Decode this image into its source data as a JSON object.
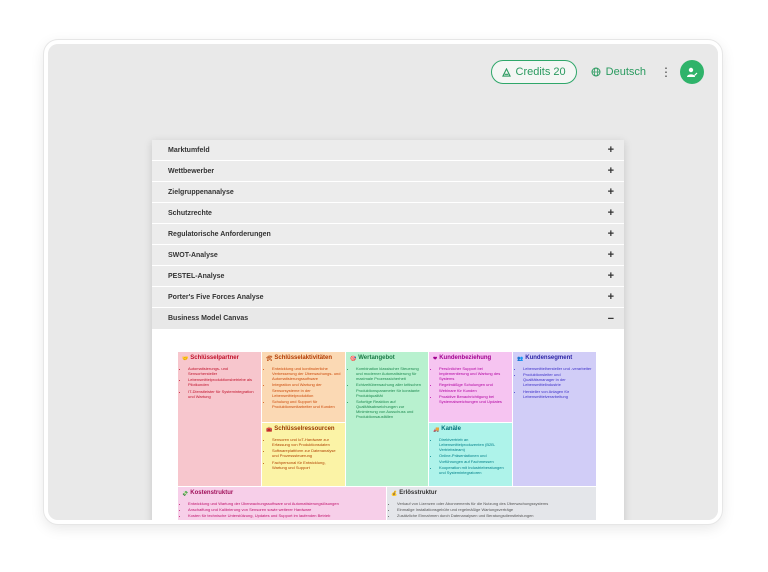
{
  "topbar": {
    "credits_label": "Credits 20",
    "language_label": "Deutsch",
    "menu_icon": "more-vertical-icon",
    "avatar_icon": "user-edit-icon",
    "accent_color": "#2fa76a"
  },
  "accordion": {
    "items": [
      {
        "label": "Marktumfeld",
        "toggle": "+"
      },
      {
        "label": "Wettbewerber",
        "toggle": "+"
      },
      {
        "label": "Zielgruppenanalyse",
        "toggle": "+"
      },
      {
        "label": "Schutzrechte",
        "toggle": "+"
      },
      {
        "label": "Regulatorische Anforderungen",
        "toggle": "+"
      },
      {
        "label": "SWOT-Analyse",
        "toggle": "+"
      },
      {
        "label": "PESTEL-Analyse",
        "toggle": "+"
      },
      {
        "label": "Porter's Five Forces Analyse",
        "toggle": "+"
      },
      {
        "label": "Business Model Canvas",
        "toggle": "−"
      }
    ]
  },
  "canvas": {
    "partner": {
      "title": "Schlüsselpartner",
      "items": [
        "Automatisierungs- und Sensorhersteller",
        "Lebensmittelproduktionsbetriebe als Pilotkunden",
        "IT-Dienstleister für Systemintegration und Wartung"
      ]
    },
    "aktivitaeten": {
      "title": "Schlüsselaktivitäten",
      "items": [
        "Entwicklung und kontinuierliche Verbesserung der Überwachungs- und Automatisierungssoftware",
        "Integration und Wartung der Sensorsysteme in der Lebensmittelproduktion",
        "Schulung und Support für Produktionsmitarbeiter und Kunden"
      ]
    },
    "ressourcen": {
      "title": "Schlüsselressourcen",
      "items": [
        "Sensoren und IoT-Hardware zur Erfassung von Produktionsdaten",
        "Softwareplattform zur Datenanalyse und Prozesssteuerung",
        "Fachpersonal für Entwicklung, Wartung und Support"
      ]
    },
    "wert": {
      "title": "Wertangebot",
      "items": [
        "Kombination klassischer Steuerung und moderner Automatisierung für maximale Prozesssicherheit",
        "Echtzeitüberwachung aller kritischen Produktionsparameter für konstante Produktqualität",
        "Sofortige Reaktion auf Qualitätsabweichungen zur Minimierung von Ausschuss und Produktionsausfällen"
      ]
    },
    "beziehung": {
      "title": "Kundenbeziehung",
      "items": [
        "Persönlicher Support bei Implementierung und Wartung des Systems",
        "Regelmäßige Schulungen und Webinare für Kunden",
        "Proaktive Benachrichtigung bei Systemabweichungen und Updates"
      ]
    },
    "kanaele": {
      "title": "Kanäle",
      "items": [
        "Direktvertrieb an Lebensmittelproduzenten (B2B-Vertriebsteam)",
        "Online-Präsentationen und Vorführungen auf Fachmessen",
        "Kooperation mit Industrieberatungen und Systemintegratoren"
      ]
    },
    "segment": {
      "title": "Kundensegment",
      "items": [
        "Lebensmittelhersteller und -verarbeiter",
        "Produktionsleiter und Qualitätsmanager in der Lebensmittelindustrie",
        "Hersteller von Anlagen für Lebensmittelverarbeitung"
      ]
    },
    "kosten": {
      "title": "Kostenstruktur",
      "items": [
        "Entwicklung und Wartung der Überwachungssoftware und Automatisierungslösungen",
        "Anschaffung und Kalibrierung von Sensoren sowie weiterer Hardware",
        "Kosten für technische Unterstützung, Updates und Support im laufenden Betrieb"
      ]
    },
    "erloese": {
      "title": "Erlösstruktur",
      "items": [
        "Verkauf von Lizenzen oder Abonnements für die Nutzung des Überwachungssystems",
        "Einmalige Installationsgebühr und regelmäßige Wartungsverträge",
        "Zusätzliche Einnahmen durch Datenanalysen und Beratungsdienstleistungen"
      ]
    }
  }
}
